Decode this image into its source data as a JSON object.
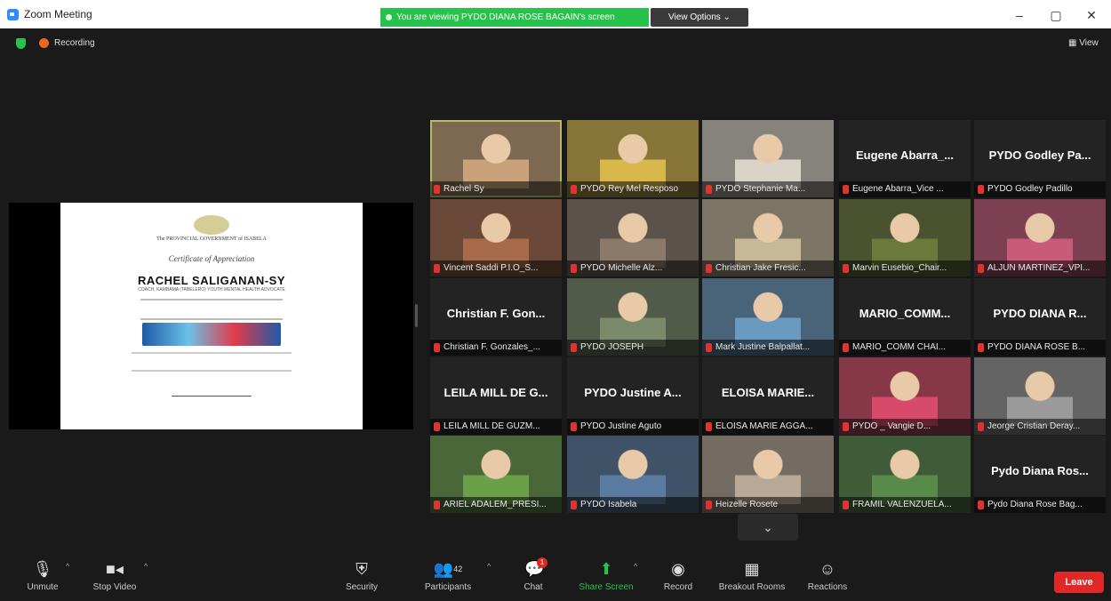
{
  "window": {
    "title": "Zoom Meeting",
    "share_banner": "You are viewing PYDO DIANA ROSE BAGAIN's screen",
    "view_options": "View Options ⌄",
    "minimize": "–",
    "restore": "▢",
    "close": "✕"
  },
  "meeting": {
    "recording_label": "Recording",
    "view_label": "▦ View"
  },
  "certificate": {
    "gov_line": "The PROVINCIAL GOVERNMENT of ISABELA",
    "title": "Certificate of Appreciation",
    "name": "RACHEL SALIGANAN-SY",
    "role": "COACH, KAMBAMA (TABELERO) YOUTH MENTAL HEALTH ADVOCATE"
  },
  "participants": [
    {
      "name": "Rachel Sy",
      "video": true,
      "active": true,
      "tone": "#c9a27a"
    },
    {
      "name": "PYDO Rey Mel Resposo",
      "video": true,
      "tone": "#d8b84a"
    },
    {
      "name": "PYDO Stephanie Ma...",
      "video": true,
      "tone": "#d9d4c8"
    },
    {
      "name": "Eugene Abarra_Vice ...",
      "display": "Eugene Abarra_...",
      "video": false
    },
    {
      "name": "PYDO Godley Padillo",
      "display": "PYDO Godley Pa...",
      "video": false
    },
    {
      "name": "Vincent Saddi P.I.O_S...",
      "video": true,
      "tone": "#a76a4a"
    },
    {
      "name": "PYDO Michelle Alz...",
      "video": true,
      "tone": "#8b7a6a"
    },
    {
      "name": "Christian Jake Fresic...",
      "video": true,
      "tone": "#c7b89a"
    },
    {
      "name": "Marvin Eusebio_Chair...",
      "video": true,
      "tone": "#6b7a3a"
    },
    {
      "name": "ALJUN MARTINEZ_VPI...",
      "video": true,
      "tone": "#c85a7a"
    },
    {
      "name": "Christian F. Gonzales_...",
      "display": "Christian F. Gon...",
      "video": false
    },
    {
      "name": "PYDO JOSEPH",
      "video": true,
      "tone": "#7a8a6a"
    },
    {
      "name": "Mark Justine Balpallat...",
      "video": true,
      "tone": "#6a9ac0"
    },
    {
      "name": "MARIO_COMM CHAI...",
      "display": "MARIO_COMM...",
      "video": false
    },
    {
      "name": "PYDO DIANA ROSE B...",
      "display": "PYDO DIANA R...",
      "video": false
    },
    {
      "name": "LEILA MILL DE GUZM...",
      "display": "LEILA MILL DE G...",
      "video": false
    },
    {
      "name": "PYDO Justine Aguto",
      "display": "PYDO Justine A...",
      "video": false
    },
    {
      "name": "ELOISA MARIE AGGA...",
      "display": "ELOISA MARIE...",
      "video": false
    },
    {
      "name": "PYDO _ Vangie D...",
      "video": true,
      "tone": "#d84a6a"
    },
    {
      "name": "Jeorge Cristian Deray...",
      "video": true,
      "tone": "#9a9a9a"
    },
    {
      "name": "ARIEL ADALEM_PRESI...",
      "video": true,
      "tone": "#6aa04a"
    },
    {
      "name": "PYDO Isabela",
      "video": true,
      "tone": "#5a7aa0"
    },
    {
      "name": "Heizelle Rosete",
      "video": true,
      "tone": "#b8a898"
    },
    {
      "name": "FRAMIL VALENZUELA...",
      "video": true,
      "tone": "#5a8a4a"
    },
    {
      "name": "Pydo Diana Rose Bag...",
      "display": "Pydo Diana Ros...",
      "video": false
    }
  ],
  "toolbar": {
    "unmute": "Unmute",
    "stop_video": "Stop Video",
    "security": "Security",
    "participants": "Participants",
    "participant_count": "42",
    "chat": "Chat",
    "chat_badge": "1",
    "share_screen": "Share Screen",
    "record": "Record",
    "breakout": "Breakout Rooms",
    "reactions": "Reactions",
    "leave": "Leave"
  },
  "colors": {
    "banner_green": "#27c24c",
    "leave_red": "#e02828",
    "active_speaker": "#a8d84a"
  }
}
